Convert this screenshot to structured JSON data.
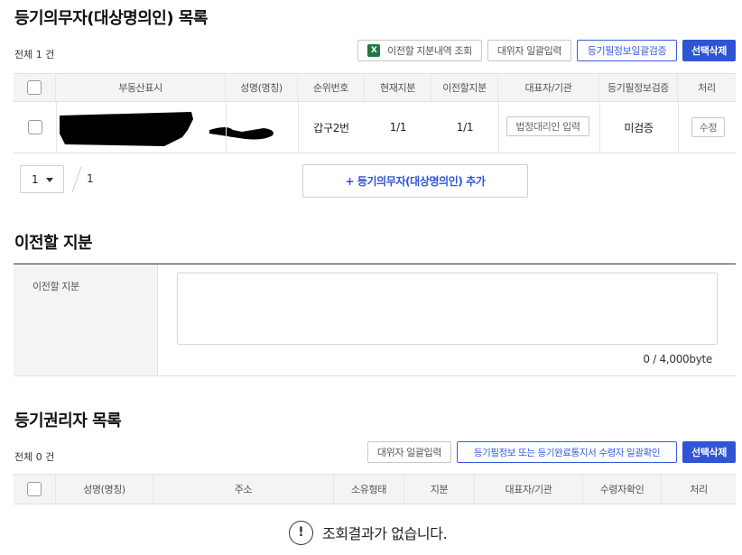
{
  "section1": {
    "title": "등기의무자(대상명의인) 목록",
    "total_count": "전체 1 건",
    "buttons": {
      "excel_query": "이전할 지분내역 조회",
      "bulk_input": "대위자 일괄입력",
      "bulk_verify": "등기필정보일괄검증",
      "delete_selected": "선택삭제"
    },
    "columns": [
      "부동산표시",
      "성명(명칭)",
      "순위번호",
      "현재지분",
      "이전할지분",
      "대표자/기관",
      "등기필정보검증",
      "처리"
    ],
    "rows": [
      {
        "rank": "갑구2번",
        "current_share": "1/1",
        "transfer_share": "1/1",
        "rep_button": "법정대리인 입력",
        "verify_status": "미검증",
        "action_button": "수정"
      }
    ],
    "pagination": {
      "page_select": "1",
      "total_pages": "1"
    },
    "add_button": "+ 등기의무자(대상명의인) 추가"
  },
  "section2": {
    "title": "이전할 지분",
    "field_label": "이전할 지분",
    "textarea_value": "",
    "byte_counter": "0 / 4,000byte"
  },
  "section3": {
    "title": "등기권리자 목록",
    "total_count": "전체 0 건",
    "buttons": {
      "bulk_input": "대위자 일괄입력",
      "bulk_confirm": "등기필정보 또는 등기완료통지서 수령자 일괄확인",
      "delete_selected": "선택삭제"
    },
    "columns": [
      "성명(명칭)",
      "주소",
      "소유형태",
      "지분",
      "대표자/기관",
      "수령자확인",
      "처리"
    ],
    "empty_message": "조회결과가 없습니다."
  },
  "colors": {
    "primary": "#2f55d4",
    "excel_green": "#1f7a44"
  },
  "icons": {
    "excel": "excel-icon",
    "dropdown": "caret-down-icon",
    "empty_notice": "exclamation-circle-icon"
  }
}
